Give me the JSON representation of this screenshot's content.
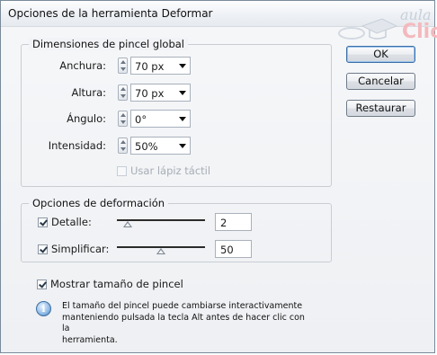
{
  "window": {
    "title": "Opciones de la herramienta Deformar"
  },
  "watermark": {
    "line1": "aula",
    "line2": "Clic"
  },
  "brush_group": {
    "legend": "Dimensiones de pincel global",
    "width": {
      "label": "Anchura:",
      "value": "70 px"
    },
    "height": {
      "label": "Altura:",
      "value": "70 px"
    },
    "angle": {
      "label": "Ángulo:",
      "value": "0°"
    },
    "intensity": {
      "label": "Intensidad:",
      "value": "50%"
    },
    "tablet": {
      "label": "Usar lápiz táctil",
      "checked": false,
      "enabled": false
    }
  },
  "warp_group": {
    "legend": "Opciones de deformación",
    "detail": {
      "label": "Detalle:",
      "checked": true,
      "value": "2",
      "slider_fraction": 0.12
    },
    "simplify": {
      "label": "Simplificar:",
      "checked": true,
      "value": "50",
      "slider_fraction": 0.5
    }
  },
  "show_brush_size": {
    "label": "Mostrar tamaño de pincel",
    "checked": true
  },
  "info": {
    "line1": "El tamaño del pincel puede cambiarse interactivamente",
    "line2": "manteniendo pulsada la tecla Alt antes de hacer clic con la",
    "line3": "herramienta."
  },
  "buttons": {
    "ok": "OK",
    "cancel": "Cancelar",
    "reset": "Restaurar"
  }
}
